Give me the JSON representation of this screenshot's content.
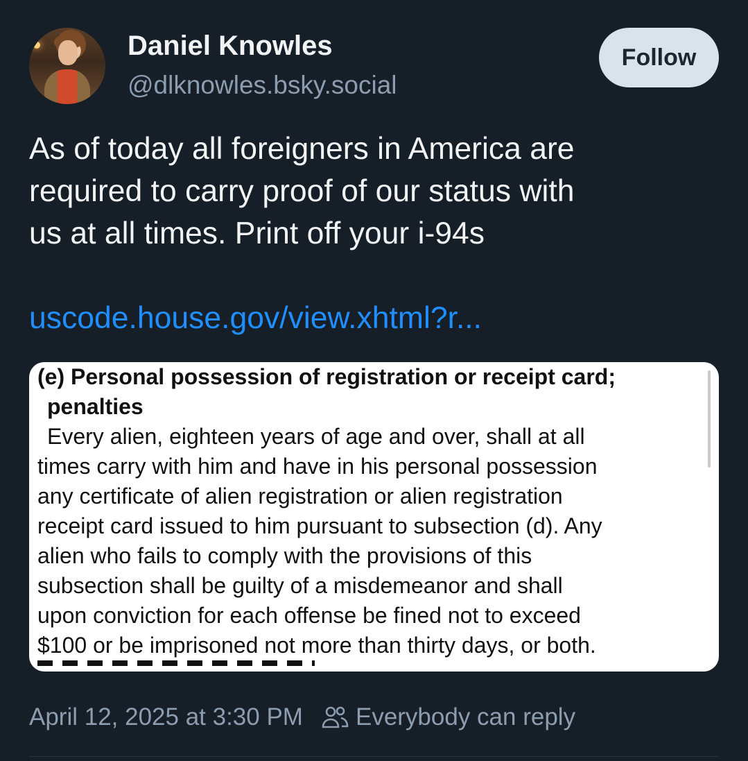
{
  "author": {
    "name": "Daniel Knowles",
    "handle": "@dlknowles.bsky.social",
    "avatar_icon": "avatar-photo"
  },
  "follow_button": {
    "label": "Follow"
  },
  "post": {
    "text_lines": [
      "As of today all foreigners in America are",
      "required to carry proof of our status with",
      "us at all times. Print off your i-94s"
    ],
    "link": "uscode.house.gov/view.xhtml?r..."
  },
  "embed": {
    "heading_lines": [
      "(e) Personal possession of registration or receipt card;",
      "penalties"
    ],
    "body_lines": [
      "Every alien, eighteen years of age and over, shall at all",
      "times carry with him and have in his personal possession",
      "any certificate of alien registration or alien registration",
      "receipt card issued to him pursuant to subsection (d). Any",
      "alien who fails to comply with the provisions of this",
      "subsection shall be guilty of a misdemeanor and shall",
      "upon conviction for each offense be fined not to exceed",
      "$100 or be imprisoned not more than thirty days, or both."
    ]
  },
  "meta": {
    "timestamp": "April 12, 2025 at 3:30 PM",
    "reply_setting": "Everybody can reply",
    "reply_icon": "people-icon"
  },
  "colors": {
    "background": "#161e27",
    "link": "#1f8fff",
    "muted": "#8d9db0",
    "follow_bg": "#dbe3ea"
  }
}
